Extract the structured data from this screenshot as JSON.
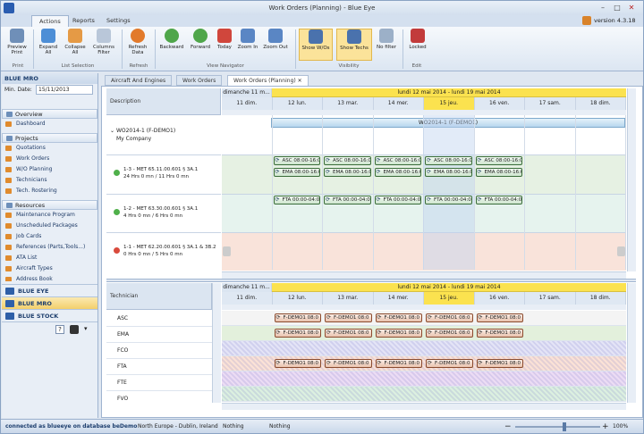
{
  "window": {
    "title": "Work Orders (Planning) - Blue Eye",
    "version": "version 4.3.18"
  },
  "ribbon_tabs": [
    "Actions",
    "Reports",
    "Settings"
  ],
  "ribbon": {
    "buttons": [
      {
        "label": "Preview\nPrint",
        "icon": "preview-print-icon"
      },
      {
        "label": "Expand\nAll",
        "icon": "expand-all-icon"
      },
      {
        "label": "Collapse\nAll",
        "icon": "collapse-all-icon"
      },
      {
        "label": "Columns\nFilter",
        "icon": "columns-filter-icon"
      },
      {
        "label": "Refresh\nData",
        "icon": "refresh-icon"
      },
      {
        "label": "Backward",
        "icon": "backward-icon"
      },
      {
        "label": "Forward",
        "icon": "forward-icon"
      },
      {
        "label": "Today",
        "icon": "calendar-icon"
      },
      {
        "label": "Zoom In",
        "icon": "zoom-in-icon"
      },
      {
        "label": "Zoom Out",
        "icon": "zoom-out-icon"
      },
      {
        "label": "Show W/Os",
        "icon": "show-wos-icon"
      },
      {
        "label": "Show Techs",
        "icon": "show-techs-icon"
      },
      {
        "label": "No filter",
        "icon": "filter-icon"
      },
      {
        "label": "Locked",
        "icon": "lock-icon"
      }
    ],
    "groups": [
      "Print",
      "List Selection",
      "Refresh",
      "View Navigator",
      "Visibility",
      "Edit"
    ]
  },
  "sidebar": {
    "title": "BLUE MRO",
    "min_date_label": "Min. Date:",
    "min_date_value": "15/11/2013",
    "sections": [
      {
        "title": "Overview",
        "items": [
          "Dashboard"
        ]
      },
      {
        "title": "Projects",
        "items": [
          "Quotations",
          "Work Orders",
          "W/O Planning",
          "Technicians",
          "Tech. Rostering"
        ]
      },
      {
        "title": "Resources",
        "items": [
          "Maintenance Program",
          "Unscheduled Packages",
          "Job Cards",
          "References (Parts,Tools...)",
          "ATA List",
          "Aircraft Types",
          "Address Book"
        ]
      }
    ],
    "modules": [
      "BLUE EYE",
      "BLUE MRO",
      "BLUE STOCK"
    ]
  },
  "doc_tabs": [
    "Aircraft And Engines",
    "Work Orders",
    "Work Orders (Planning)"
  ],
  "schedule": {
    "description_header": "Description",
    "week_left": "dimanche 11 m...",
    "week_range": "lundi 12 mai 2014 - lundi 19 mai 2014",
    "days": [
      "11 dim.",
      "12 lun.",
      "13 mar.",
      "14 mer.",
      "15 jeu.",
      "16 ven.",
      "17 sam.",
      "18 dim."
    ],
    "wo_title": "WO2014-1 (F-DEMO1)",
    "wo_company": "My Company",
    "tasks": [
      {
        "line1": "1-3 - MET 65.11.00.601 § 3A.1",
        "line2": "24 Hrs 0 mn / 11 Hrs 0 mn"
      },
      {
        "line1": "1-2 - MET 63.30.00.601 § 3A.1",
        "line2": "4 Hrs 0 mn / 6 Hrs 0 mn"
      },
      {
        "line1": "1-1 - MET 62.20.00.601 § 3A.1 & 3B.2",
        "line2": "0 Hrs 0 mn / 5 Hrs 0 mn"
      }
    ],
    "asc_event": "ASC 08:00-16:0",
    "ema_event": "EMA 08:00-16:0",
    "fta_event": "FTA 00:00-04:0"
  },
  "technicians": {
    "header": "Technician",
    "rows": [
      "ASC",
      "EMA",
      "FCO",
      "FTA",
      "FTE",
      "FVO"
    ],
    "event_label": "F-DEMO1 08:0"
  },
  "status": {
    "connection": "connected as blueeye on database beDemo",
    "timezone": "North Europe - Dublin, Ireland",
    "s1": "Nothing",
    "s2": "Nothing",
    "zoom": "100%"
  }
}
